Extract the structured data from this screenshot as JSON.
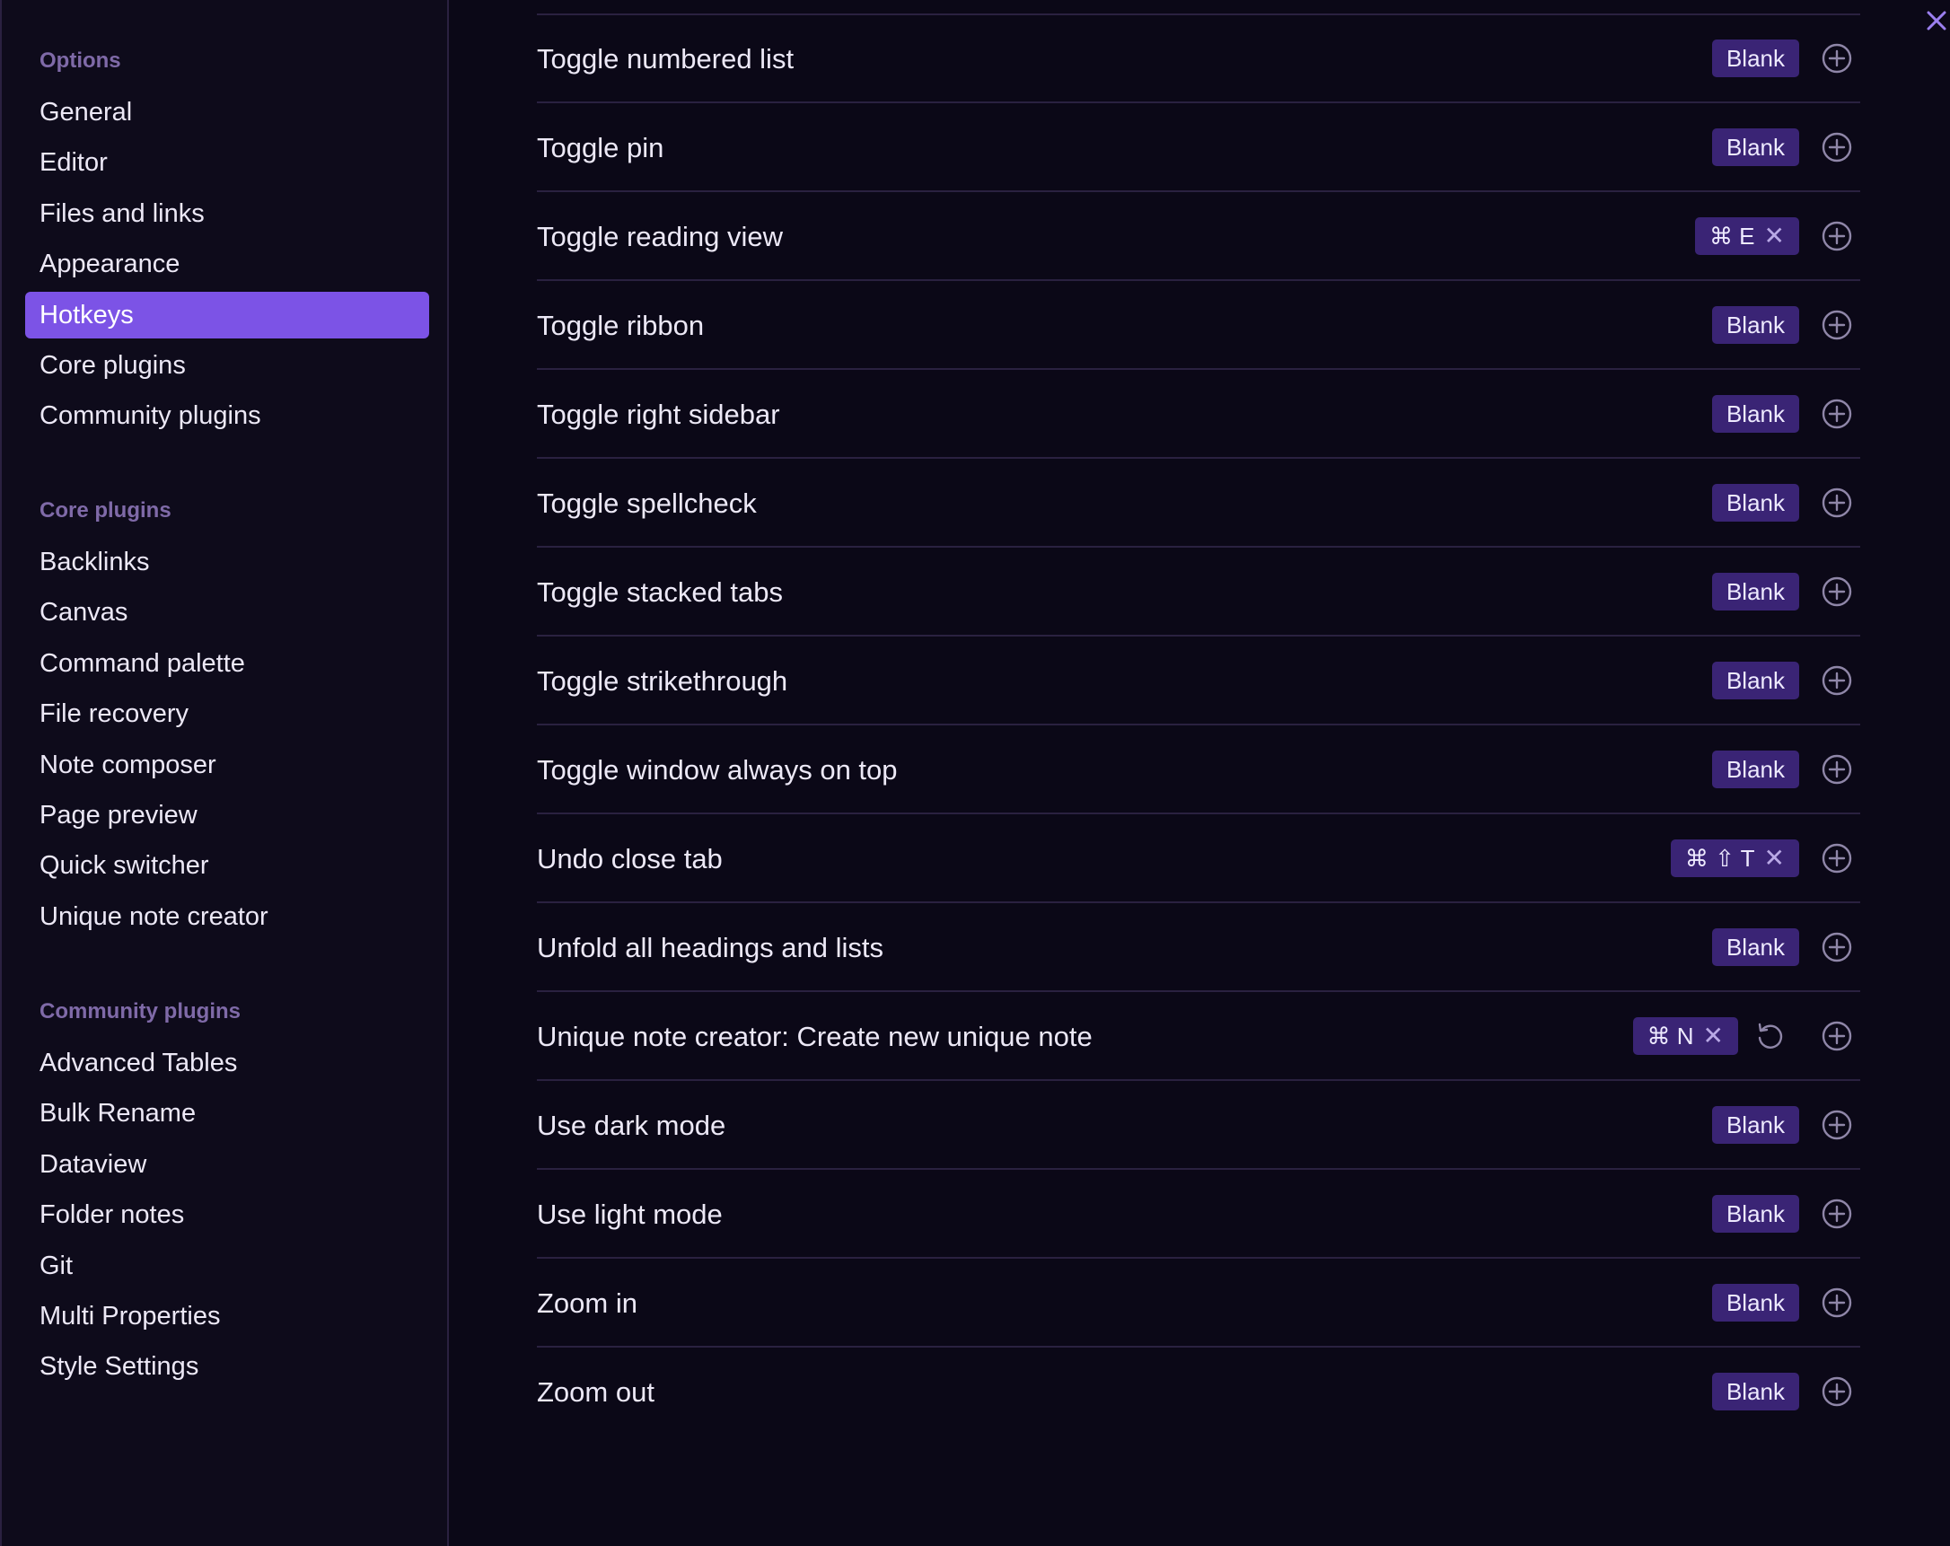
{
  "sidebar": {
    "options_title": "Options",
    "options": [
      {
        "label": "General"
      },
      {
        "label": "Editor"
      },
      {
        "label": "Files and links"
      },
      {
        "label": "Appearance"
      },
      {
        "label": "Hotkeys",
        "active": true
      },
      {
        "label": "Core plugins"
      },
      {
        "label": "Community plugins"
      }
    ],
    "core_title": "Core plugins",
    "core_plugins": [
      {
        "label": "Backlinks"
      },
      {
        "label": "Canvas"
      },
      {
        "label": "Command palette"
      },
      {
        "label": "File recovery"
      },
      {
        "label": "Note composer"
      },
      {
        "label": "Page preview"
      },
      {
        "label": "Quick switcher"
      },
      {
        "label": "Unique note creator"
      }
    ],
    "community_title": "Community plugins",
    "community_plugins": [
      {
        "label": "Advanced Tables"
      },
      {
        "label": "Bulk Rename"
      },
      {
        "label": "Dataview"
      },
      {
        "label": "Folder notes"
      },
      {
        "label": "Git"
      },
      {
        "label": "Multi Properties"
      },
      {
        "label": "Style Settings"
      }
    ]
  },
  "hotkeys": [
    {
      "name": "Toggle numbered list",
      "hotkey": "Blank",
      "removable": false
    },
    {
      "name": "Toggle pin",
      "hotkey": "Blank",
      "removable": false
    },
    {
      "name": "Toggle reading view",
      "hotkey": "⌘ E",
      "removable": true
    },
    {
      "name": "Toggle ribbon",
      "hotkey": "Blank",
      "removable": false
    },
    {
      "name": "Toggle right sidebar",
      "hotkey": "Blank",
      "removable": false
    },
    {
      "name": "Toggle spellcheck",
      "hotkey": "Blank",
      "removable": false
    },
    {
      "name": "Toggle stacked tabs",
      "hotkey": "Blank",
      "removable": false
    },
    {
      "name": "Toggle strikethrough",
      "hotkey": "Blank",
      "removable": false
    },
    {
      "name": "Toggle window always on top",
      "hotkey": "Blank",
      "removable": false
    },
    {
      "name": "Undo close tab",
      "hotkey": "⌘ ⇧ T",
      "removable": true
    },
    {
      "name": "Unfold all headings and lists",
      "hotkey": "Blank",
      "removable": false
    },
    {
      "name": "Unique note creator: Create new unique note",
      "hotkey": "⌘ N",
      "removable": true,
      "resettable": true
    },
    {
      "name": "Use dark mode",
      "hotkey": "Blank",
      "removable": false
    },
    {
      "name": "Use light mode",
      "hotkey": "Blank",
      "removable": false
    },
    {
      "name": "Zoom in",
      "hotkey": "Blank",
      "removable": false
    },
    {
      "name": "Zoom out",
      "hotkey": "Blank",
      "removable": false
    }
  ],
  "icons": {
    "close": "close-icon",
    "add": "plus-circle-icon",
    "remove": "x-icon",
    "reset": "reset-icon"
  },
  "colors": {
    "accent": "#7c53e6",
    "hotkey_bg": "#3a2475",
    "background": "#0b0817",
    "section_title": "#7f6aa8"
  }
}
